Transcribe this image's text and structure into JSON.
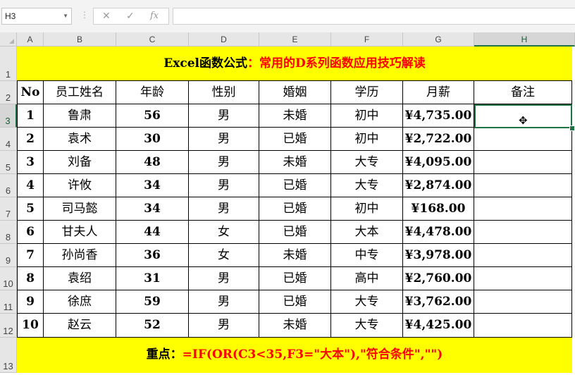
{
  "formula_bar": {
    "name_box": "H3",
    "cancel_icon": "✕",
    "enter_icon": "✓",
    "fx_label": "fx",
    "formula_value": ""
  },
  "columns": [
    "A",
    "B",
    "C",
    "D",
    "E",
    "F",
    "G",
    "H"
  ],
  "rows": [
    "1",
    "2",
    "3",
    "4",
    "5",
    "6",
    "7",
    "8",
    "9",
    "10",
    "11",
    "12",
    "13"
  ],
  "title": {
    "part1": "Excel函数公式",
    "part2": "：常用的D系列函数应用技巧解读"
  },
  "table": {
    "headers": [
      "No",
      "员工姓名",
      "年龄",
      "性别",
      "婚姻",
      "学历",
      "月薪",
      "备注"
    ],
    "rows": [
      [
        "1",
        "鲁肃",
        "56",
        "男",
        "未婚",
        "初中",
        "¥4,735.00",
        ""
      ],
      [
        "2",
        "袁术",
        "30",
        "男",
        "已婚",
        "初中",
        "¥2,722.00",
        ""
      ],
      [
        "3",
        "刘备",
        "48",
        "男",
        "未婚",
        "大专",
        "¥4,095.00",
        ""
      ],
      [
        "4",
        "许攸",
        "34",
        "男",
        "已婚",
        "大专",
        "¥2,874.00",
        ""
      ],
      [
        "5",
        "司马懿",
        "34",
        "男",
        "已婚",
        "初中",
        "¥168.00",
        ""
      ],
      [
        "6",
        "甘夫人",
        "44",
        "女",
        "已婚",
        "大本",
        "¥4,478.00",
        ""
      ],
      [
        "7",
        "孙尚香",
        "36",
        "女",
        "未婚",
        "中专",
        "¥3,978.00",
        ""
      ],
      [
        "8",
        "袁绍",
        "31",
        "男",
        "已婚",
        "高中",
        "¥2,760.00",
        ""
      ],
      [
        "9",
        "徐庶",
        "59",
        "男",
        "已婚",
        "大专",
        "¥3,762.00",
        ""
      ],
      [
        "10",
        "赵云",
        "52",
        "男",
        "未婚",
        "大专",
        "¥4,425.00",
        ""
      ]
    ]
  },
  "footer": {
    "label": "重点：",
    "formula": "=IF(OR(C3<35,F3=\"大本\"),\"符合条件\",\"\")"
  },
  "selected": {
    "column": "H",
    "row": "3"
  },
  "colors": {
    "band": "#ffff00",
    "accent_red": "#ff0000",
    "excel_green": "#217346"
  }
}
